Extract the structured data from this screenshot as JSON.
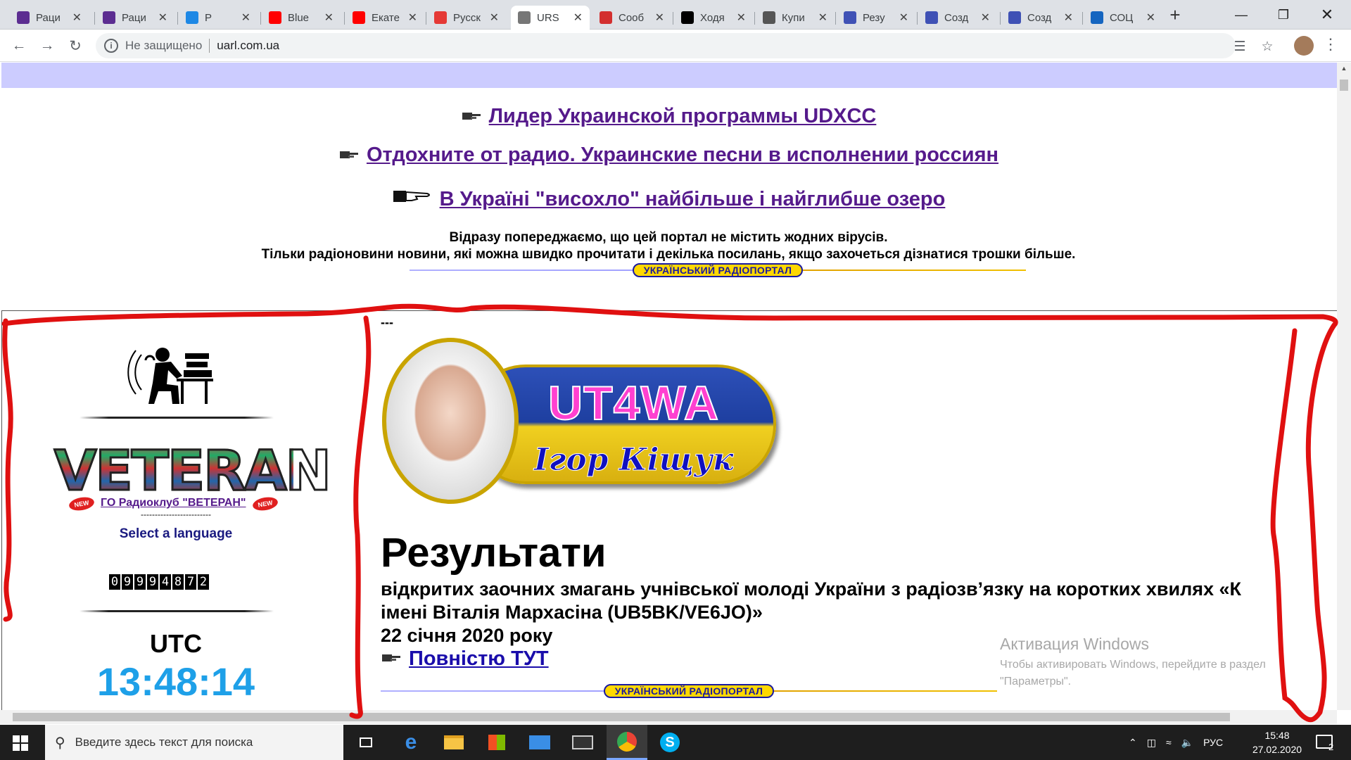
{
  "browser": {
    "tabs": [
      {
        "title": "Раци",
        "color": "#5c2d91"
      },
      {
        "title": "Раци",
        "color": "#5c2d91"
      },
      {
        "title": "Р",
        "color": "#1e88e5"
      },
      {
        "title": "Blue",
        "color": "#ff0000"
      },
      {
        "title": "Екате",
        "color": "#ff0000"
      },
      {
        "title": "Русск",
        "color": "#e53935"
      },
      {
        "title": "URS",
        "color": "#777777"
      },
      {
        "title": "Сооб",
        "color": "#d32f2f"
      },
      {
        "title": "Ходя",
        "color": "#000000"
      },
      {
        "title": "Купи",
        "color": "#555555"
      },
      {
        "title": "Резу",
        "color": "#3f51b5"
      },
      {
        "title": "Созд",
        "color": "#3f51b5"
      },
      {
        "title": "Созд",
        "color": "#3f51b5"
      },
      {
        "title": "СОЦ",
        "color": "#1565c0"
      }
    ],
    "active_tab_index": 6,
    "security_label": "Не защищено",
    "url": "uarl.com.ua"
  },
  "page": {
    "promo_links": [
      "Лидер Украинской программы UDXCC",
      "Отдохните от радио. Украинские песни в исполнении россиян",
      "В Україні \"висохло\" найбільше і найглибше озеро"
    ],
    "notice_line1": "Відразу попереджаємо, що цей портал не містить жодних вірусів.",
    "notice_line2": "Тільки радіоновини новини, які можна швидко прочитати і декілька посилань, якщо захочеться дізнатися трошки більше.",
    "portal_banner": "УКРАЇНСЬКИЙ РАДІОПОРТАЛ",
    "dashes": "---",
    "sidebar": {
      "logo_text": "VETERAN",
      "new_badge": "NEW",
      "club_link": "ГО Радиоклуб \"ВЕТЕРАН\"",
      "dashes": "-------------------------",
      "select_language": "Select a language",
      "counter_digits": [
        "0",
        "9",
        "9",
        "9",
        "4",
        "8",
        "7",
        "2"
      ],
      "utc_label": "UTC",
      "utc_time": "13:48:14"
    },
    "main": {
      "callsign": "UT4WA",
      "name_script": "Ігор Кіщук",
      "heading": "Результати",
      "sub_line1": "відкритих заочних змагань учнівської молоді України з радіозв’язку на коротких хвилях «К",
      "sub_line2": "імені Віталія Мархасіна (UB5BK/VE6JO)»",
      "sub_line3": "22 січня 2020 року",
      "more_link": "Повністю ТУТ"
    },
    "watermark_title": "Активация Windows",
    "watermark_text1": "Чтобы активировать Windows, перейдите в раздел",
    "watermark_text2": "\"Параметры\"."
  },
  "taskbar": {
    "search_placeholder": "Введите здесь текст для поиска",
    "lang": "РУС",
    "time": "15:48",
    "date": "27.02.2020",
    "notifications": "2"
  },
  "colors": {
    "link_visited": "#551a8b",
    "link": "#1a0dab",
    "utc_time": "#1ea0e8",
    "annotation": "#e01010",
    "header_band": "#ccccff"
  }
}
